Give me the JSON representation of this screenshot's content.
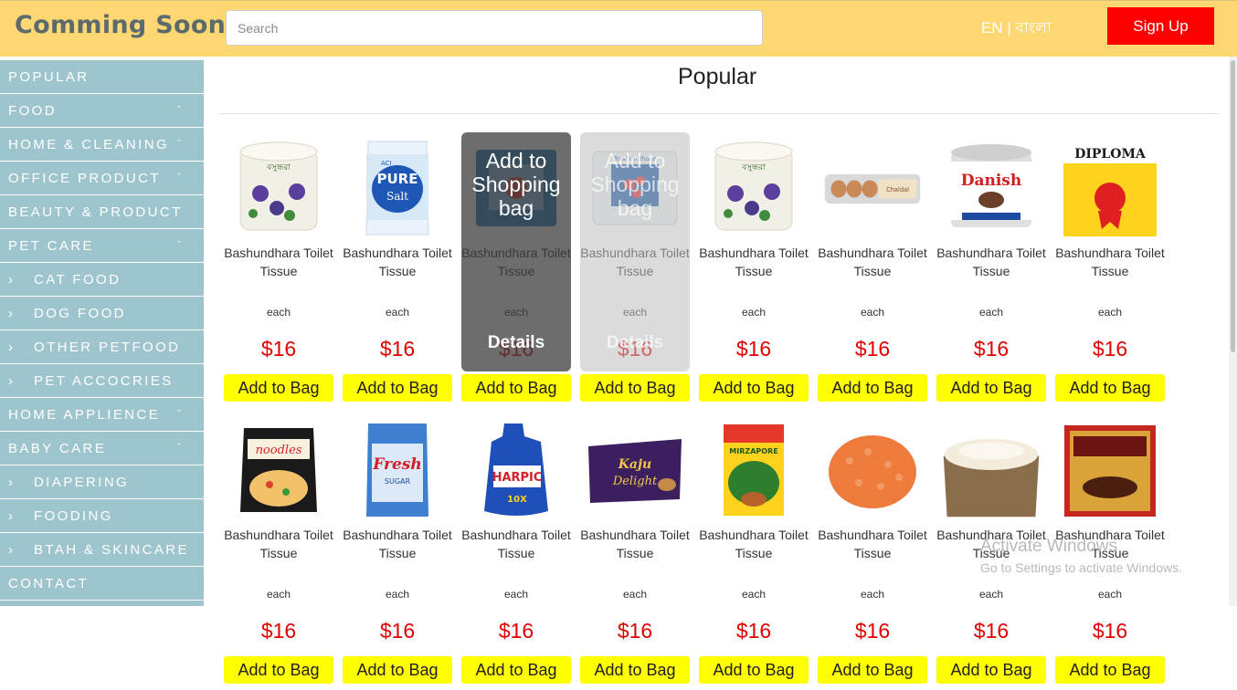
{
  "header": {
    "brand": "Comming Soon",
    "search_placeholder": "Search",
    "lang_en": "EN",
    "lang_sep": " | ",
    "lang_bn": "বাংলা",
    "signup_label": "Sign Up"
  },
  "sidebar": {
    "items": [
      {
        "label": "POPULAR",
        "chevron": "",
        "sub": false
      },
      {
        "label": "FOOD",
        "chevron": "ˇ",
        "sub": false
      },
      {
        "label": "HOME & CLEANING",
        "chevron": "ˇ",
        "sub": false
      },
      {
        "label": "OFFICE PRODUCT",
        "chevron": "ˇ",
        "sub": false
      },
      {
        "label": "BEAUTY & PRODUCT",
        "chevron": "ˇ",
        "sub": false
      },
      {
        "label": "PET CARE",
        "chevron": "ˆ",
        "sub": false
      },
      {
        "label": "CAT FOOD",
        "chevron": "",
        "sub": true
      },
      {
        "label": "DOG FOOD",
        "chevron": "",
        "sub": true
      },
      {
        "label": "OTHER PETFOOD",
        "chevron": "",
        "sub": true
      },
      {
        "label": "PET ACCOCRIES",
        "chevron": "",
        "sub": true
      },
      {
        "label": "HOME APPLIENCE",
        "chevron": "ˇ",
        "sub": false
      },
      {
        "label": "BABY CARE",
        "chevron": "ˆ",
        "sub": false
      },
      {
        "label": "DIAPERING",
        "chevron": "",
        "sub": true
      },
      {
        "label": "FOODING",
        "chevron": "",
        "sub": true
      },
      {
        "label": "BTAH & SKINCARE",
        "chevron": "",
        "sub": true
      },
      {
        "label": "CONTACT",
        "chevron": "",
        "sub": false
      }
    ],
    "sub_arrow": "›"
  },
  "main": {
    "title": "Popular",
    "overlay_add": "Add to Shopping bag",
    "overlay_details": "Details",
    "products": [
      {
        "name": "Bashundhara Toilet Tissue",
        "unit": "each",
        "price": "$16",
        "button": "Add to Bag",
        "image": "toilet-roll-icon"
      },
      {
        "name": "Bashundhara Toilet Tissue",
        "unit": "each",
        "price": "$16",
        "button": "Add to Bag",
        "image": "salt-pack-icon"
      },
      {
        "name": "Bashundhara Toilet Tissue",
        "unit": "each",
        "price": "$16",
        "button": "Add to Bag",
        "image": "napkin-pack-icon"
      },
      {
        "name": "Bashundhara Toilet Tissue",
        "unit": "each",
        "price": "$16",
        "button": "Add to Bag",
        "image": "tissue-box-icon"
      },
      {
        "name": "Bashundhara Toilet Tissue",
        "unit": "each",
        "price": "$16",
        "button": "Add to Bag",
        "image": "toilet-roll-icon"
      },
      {
        "name": "Bashundhara Toilet Tissue",
        "unit": "each",
        "price": "$16",
        "button": "Add to Bag",
        "image": "egg-tray-icon"
      },
      {
        "name": "Bashundhara Toilet Tissue",
        "unit": "each",
        "price": "$16",
        "button": "Add to Bag",
        "image": "milk-can-icon"
      },
      {
        "name": "Bashundhara Toilet Tissue",
        "unit": "each",
        "price": "$16",
        "button": "Add to Bag",
        "image": "milk-powder-icon"
      },
      {
        "name": "Bashundhara Toilet Tissue",
        "unit": "each",
        "price": "$16",
        "button": "Add to Bag",
        "image": "noodles-pack-icon"
      },
      {
        "name": "Bashundhara Toilet Tissue",
        "unit": "each",
        "price": "$16",
        "button": "Add to Bag",
        "image": "sugar-bag-icon"
      },
      {
        "name": "Bashundhara Toilet Tissue",
        "unit": "each",
        "price": "$16",
        "button": "Add to Bag",
        "image": "cleaner-bottle-icon"
      },
      {
        "name": "Bashundhara Toilet Tissue",
        "unit": "each",
        "price": "$16",
        "button": "Add to Bag",
        "image": "chocolate-bar-icon"
      },
      {
        "name": "Bashundhara Toilet Tissue",
        "unit": "each",
        "price": "$16",
        "button": "Add to Bag",
        "image": "tea-pack-icon"
      },
      {
        "name": "Bashundhara Toilet Tissue",
        "unit": "each",
        "price": "$16",
        "button": "Add to Bag",
        "image": "lentils-icon"
      },
      {
        "name": "Bashundhara Toilet Tissue",
        "unit": "each",
        "price": "$16",
        "button": "Add to Bag",
        "image": "flour-sack-icon"
      },
      {
        "name": "Bashundhara Toilet Tissue",
        "unit": "each",
        "price": "$16",
        "button": "Add to Bag",
        "image": "spice-box-icon"
      }
    ]
  },
  "watermark": {
    "line1": "Activate Windows",
    "line2": "Go to Settings to activate Windows."
  },
  "colors": {
    "header_bg": "#fdd772",
    "sidebar_bg": "#9ec5cd",
    "price": "#e00000",
    "add_button": "#ffff00",
    "signup": "#ff0000"
  }
}
